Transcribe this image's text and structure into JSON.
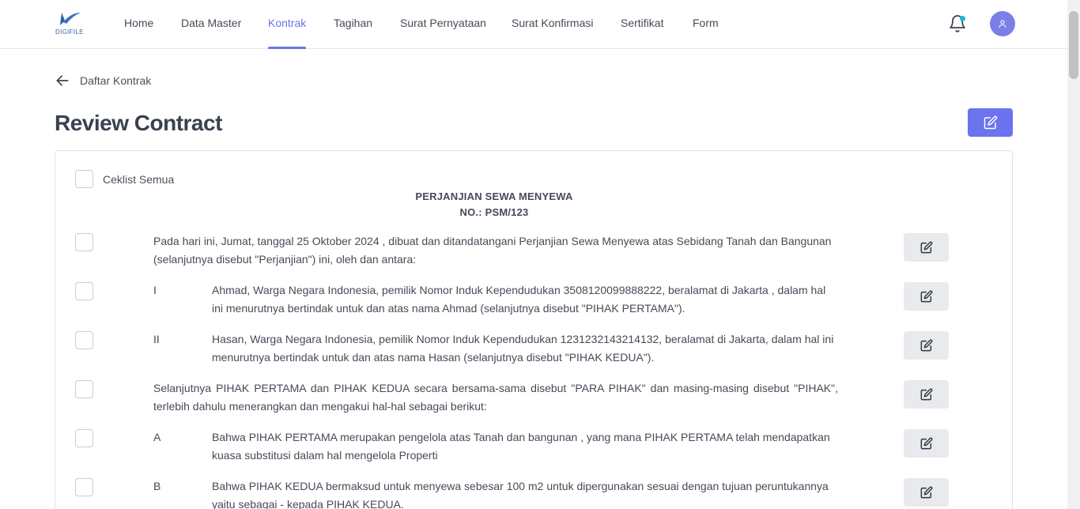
{
  "brand": {
    "logo_text": "DIGIFILE"
  },
  "nav": {
    "items": [
      {
        "label": "Home",
        "active": false
      },
      {
        "label": "Data Master",
        "active": false
      },
      {
        "label": "Kontrak",
        "active": true
      },
      {
        "label": "Tagihan",
        "active": false
      },
      {
        "label": "Surat Pernyataan",
        "active": false
      },
      {
        "label": "Surat Konfirmasi",
        "active": false
      },
      {
        "label": "Sertifikat",
        "active": false
      },
      {
        "label": "Form",
        "active": false
      }
    ],
    "icons": {
      "notification": "bell-icon",
      "profile": "user-icon"
    }
  },
  "breadcrumb": {
    "back_label": "Daftar Kontrak",
    "back_icon": "arrow-left-icon"
  },
  "page": {
    "title": "Review Contract",
    "edit_icon": "edit-icon"
  },
  "contract": {
    "check_all_label": "Ceklist Semua",
    "title": "PERJANJIAN SEWA MENYEWA",
    "number": "NO.: PSM/123",
    "clauses": [
      {
        "marker": "",
        "text": "Pada hari ini, Jumat, tanggal 25 Oktober 2024 , dibuat dan ditandatangani Perjanjian Sewa Menyewa atas Sebidang Tanah dan Bangunan (selanjutnya disebut \"Perjanjian\") ini, oleh dan antara:"
      },
      {
        "marker": "I",
        "text": "Ahmad, Warga Negara Indonesia, pemilik Nomor Induk Kependudukan 3508120099888222, beralamat di Jakarta , dalam hal ini menurutnya bertindak untuk dan atas nama Ahmad (selanjutnya disebut \"PIHAK PERTAMA\")."
      },
      {
        "marker": "II",
        "text": "Hasan, Warga Negara Indonesia, pemilik Nomor Induk Kependudukan 1231232143214132, beralamat di Jakarta, dalam hal ini menurutnya bertindak untuk dan atas nama Hasan (selanjutnya disebut \"PIHAK KEDUA\")."
      },
      {
        "marker": "",
        "text": "Selanjutnya PIHAK PERTAMA dan PIHAK KEDUA secara bersama-sama disebut \"PARA PIHAK\" dan masing-masing disebut \"PIHAK\", terlebih dahulu menerangkan dan mengakui hal-hal sebagai berikut:"
      },
      {
        "marker": "A",
        "text": "Bahwa PIHAK PERTAMA merupakan pengelola atas Tanah dan bangunan , yang mana PIHAK PERTAMA telah mendapatkan kuasa substitusi dalam hal mengelola Properti"
      },
      {
        "marker": "B",
        "text": "Bahwa PIHAK KEDUA bermaksud untuk menyewa sebesar 100 m2 untuk dipergunakan sesuai dengan tujuan peruntukannya yaitu sebagai - kepada PIHAK KEDUA."
      }
    ]
  },
  "colors": {
    "accent": "#6c73e8",
    "button_secondary": "#e8eaee",
    "notification_dot": "#22b8cf"
  }
}
